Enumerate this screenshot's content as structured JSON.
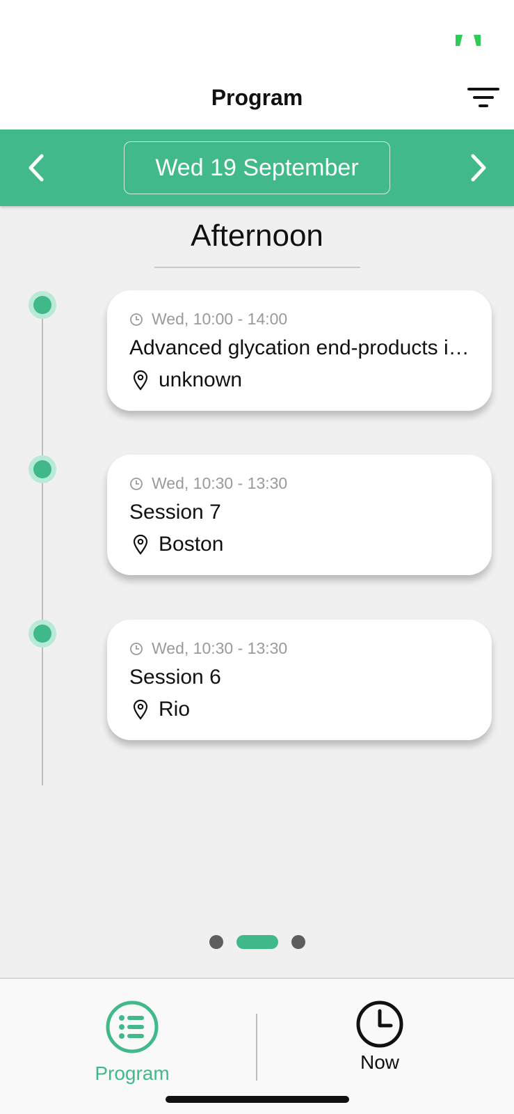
{
  "nav": {
    "title": "Program"
  },
  "date_bar": {
    "date_label": "Wed 19 September"
  },
  "section": {
    "title": "Afternoon"
  },
  "sessions": [
    {
      "time": "Wed, 10:00 - 14:00",
      "title": "Advanced glycation end-products in human health",
      "location": "unknown"
    },
    {
      "time": "Wed, 10:30 - 13:30",
      "title": "Session 7",
      "location": "Boston"
    },
    {
      "time": "Wed, 10:30 - 13:30",
      "title": "Session 6",
      "location": "Rio"
    }
  ],
  "pager": {
    "pages": 3,
    "active_index": 1
  },
  "tabs": [
    {
      "label": "Program",
      "icon": "list-icon",
      "active": true
    },
    {
      "label": "Now",
      "icon": "clock-icon",
      "active": false
    }
  ],
  "colors": {
    "accent": "#42b98b",
    "dot_ring": "#b8ead7",
    "inactive": "#111111"
  }
}
